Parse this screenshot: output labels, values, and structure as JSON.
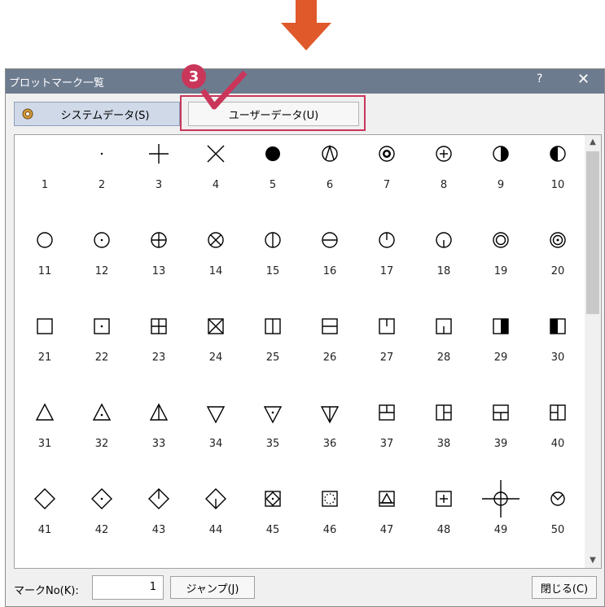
{
  "window": {
    "title": "プロットマーク一覧",
    "help": "?",
    "close": "✕"
  },
  "tabs": {
    "system_label": "システムデータ(S)",
    "user_label": "ユーザーデータ(U)"
  },
  "callout": {
    "step": "3"
  },
  "marks": [
    {
      "no": "1",
      "shape": "blank"
    },
    {
      "no": "2",
      "shape": "dot"
    },
    {
      "no": "3",
      "shape": "plus"
    },
    {
      "no": "4",
      "shape": "x"
    },
    {
      "no": "5",
      "shape": "circle-filled"
    },
    {
      "no": "6",
      "shape": "circle-vtriangle"
    },
    {
      "no": "7",
      "shape": "circle-flower"
    },
    {
      "no": "8",
      "shape": "circle-plus"
    },
    {
      "no": "9",
      "shape": "circle-half-right"
    },
    {
      "no": "10",
      "shape": "circle-half-left"
    },
    {
      "no": "11",
      "shape": "circle"
    },
    {
      "no": "12",
      "shape": "circle-dot"
    },
    {
      "no": "13",
      "shape": "circle-cross-full"
    },
    {
      "no": "14",
      "shape": "circle-x"
    },
    {
      "no": "15",
      "shape": "circle-vline"
    },
    {
      "no": "16",
      "shape": "circle-hline"
    },
    {
      "no": "17",
      "shape": "circle-top-line"
    },
    {
      "no": "18",
      "shape": "circle-bottom-line"
    },
    {
      "no": "19",
      "shape": "circle-double"
    },
    {
      "no": "20",
      "shape": "circle-triple"
    },
    {
      "no": "21",
      "shape": "square"
    },
    {
      "no": "22",
      "shape": "square-dot"
    },
    {
      "no": "23",
      "shape": "square-plus"
    },
    {
      "no": "24",
      "shape": "square-x"
    },
    {
      "no": "25",
      "shape": "square-vline"
    },
    {
      "no": "26",
      "shape": "square-hline"
    },
    {
      "no": "27",
      "shape": "square-top-line"
    },
    {
      "no": "28",
      "shape": "square-bottom-line"
    },
    {
      "no": "29",
      "shape": "square-half-right"
    },
    {
      "no": "30",
      "shape": "square-half-left"
    },
    {
      "no": "31",
      "shape": "triangle"
    },
    {
      "no": "32",
      "shape": "triangle-dot"
    },
    {
      "no": "33",
      "shape": "triangle-vline"
    },
    {
      "no": "34",
      "shape": "triangle-down"
    },
    {
      "no": "35",
      "shape": "triangle-down-dot"
    },
    {
      "no": "36",
      "shape": "triangle-down-vline"
    },
    {
      "no": "37",
      "shape": "square-t-top"
    },
    {
      "no": "38",
      "shape": "square-t-left"
    },
    {
      "no": "39",
      "shape": "square-t-bottom"
    },
    {
      "no": "40",
      "shape": "square-t-right"
    },
    {
      "no": "41",
      "shape": "diamond"
    },
    {
      "no": "42",
      "shape": "diamond-dot"
    },
    {
      "no": "43",
      "shape": "diamond-top-line"
    },
    {
      "no": "44",
      "shape": "diamond-bottom-line"
    },
    {
      "no": "45",
      "shape": "square-diamond-dot"
    },
    {
      "no": "46",
      "shape": "square-dotted-circle"
    },
    {
      "no": "47",
      "shape": "square-triangle"
    },
    {
      "no": "48",
      "shape": "square-plus-small"
    },
    {
      "no": "49",
      "shape": "crosshair"
    },
    {
      "no": "50",
      "shape": "circle-v"
    }
  ],
  "footer": {
    "mark_no_label": "マークNo(K):",
    "mark_no_value": "1",
    "jump_label": "ジャンプ(J)",
    "close_label": "閉じる(C)"
  },
  "colors": {
    "arrow": "#e0592a",
    "highlight": "#c9365a",
    "titlebar": "#6d7b8f"
  },
  "icons": {
    "download_arrow": "arrow-down-icon",
    "system_tab": "system-data-icon"
  }
}
